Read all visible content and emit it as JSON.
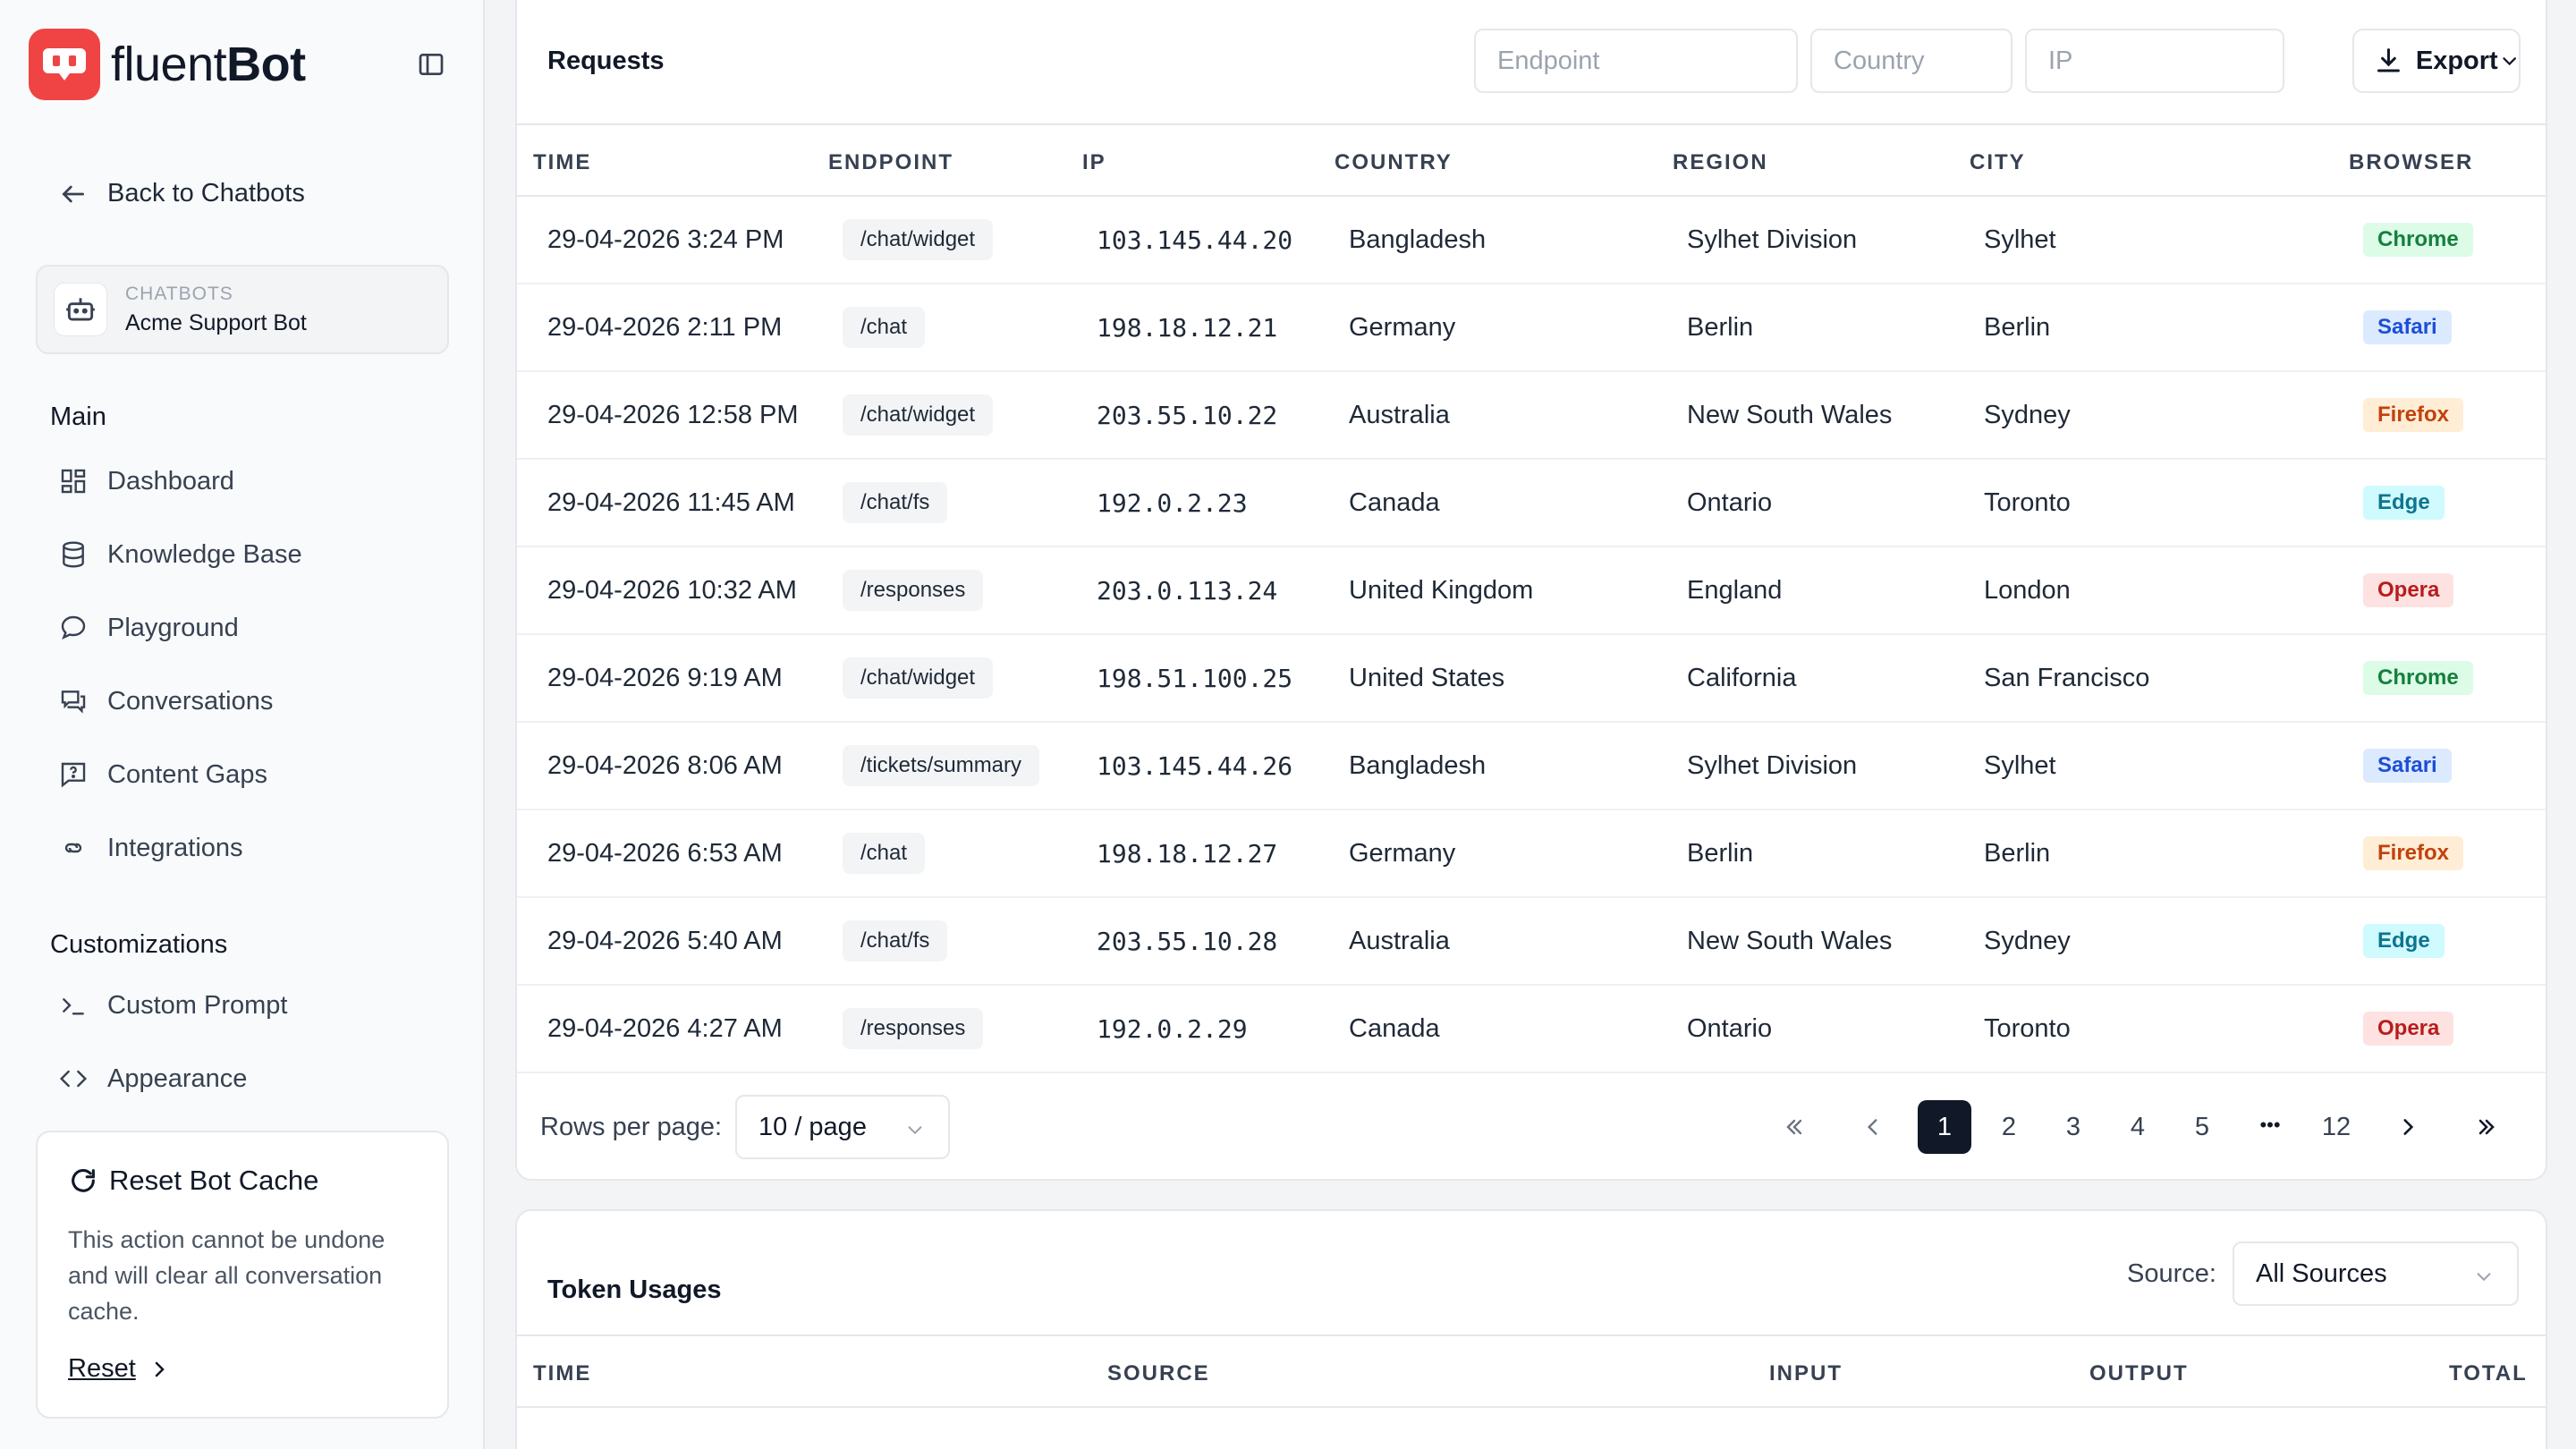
{
  "brand": {
    "name_part1": "fluent",
    "name_part2": "Bot"
  },
  "nav": {
    "back_label": "Back to Chatbots",
    "bot_card": {
      "kicker": "CHATBOTS",
      "name": "Acme Support Bot"
    },
    "main_title": "Main",
    "main_items": [
      {
        "label": "Dashboard",
        "icon": "dashboard-icon"
      },
      {
        "label": "Knowledge Base",
        "icon": "database-icon"
      },
      {
        "label": "Playground",
        "icon": "chat-bubble-icon"
      },
      {
        "label": "Conversations",
        "icon": "conversations-icon"
      },
      {
        "label": "Content Gaps",
        "icon": "question-message-icon"
      },
      {
        "label": "Integrations",
        "icon": "integrations-icon"
      }
    ],
    "custom_title": "Customizations",
    "custom_items": [
      {
        "label": "Custom Prompt",
        "icon": "terminal-icon"
      },
      {
        "label": "Appearance",
        "icon": "code-brackets-icon"
      }
    ]
  },
  "cache": {
    "title": "Reset Bot Cache",
    "description": "This action cannot be undone and will clear all conversation cache.",
    "reset_label": "Reset"
  },
  "requests": {
    "title": "Requests",
    "filters": {
      "endpoint_placeholder": "Endpoint",
      "country_placeholder": "Country",
      "ip_placeholder": "IP"
    },
    "export_label": "Export",
    "columns": [
      "TIME",
      "ENDPOINT",
      "IP",
      "COUNTRY",
      "REGION",
      "CITY",
      "BROWSER"
    ],
    "rows": [
      {
        "time": "29-04-2026 3:24 PM",
        "endpoint": "/chat/widget",
        "ip": "103.145.44.20",
        "country": "Bangladesh",
        "region": "Sylhet Division",
        "city": "Sylhet",
        "browser": "Chrome"
      },
      {
        "time": "29-04-2026 2:11 PM",
        "endpoint": "/chat",
        "ip": "198.18.12.21",
        "country": "Germany",
        "region": "Berlin",
        "city": "Berlin",
        "browser": "Safari"
      },
      {
        "time": "29-04-2026 12:58 PM",
        "endpoint": "/chat/widget",
        "ip": "203.55.10.22",
        "country": "Australia",
        "region": "New South Wales",
        "city": "Sydney",
        "browser": "Firefox"
      },
      {
        "time": "29-04-2026 11:45 AM",
        "endpoint": "/chat/fs",
        "ip": "192.0.2.23",
        "country": "Canada",
        "region": "Ontario",
        "city": "Toronto",
        "browser": "Edge"
      },
      {
        "time": "29-04-2026 10:32 AM",
        "endpoint": "/responses",
        "ip": "203.0.113.24",
        "country": "United Kingdom",
        "region": "England",
        "city": "London",
        "browser": "Opera"
      },
      {
        "time": "29-04-2026 9:19 AM",
        "endpoint": "/chat/widget",
        "ip": "198.51.100.25",
        "country": "United States",
        "region": "California",
        "city": "San Francisco",
        "browser": "Chrome"
      },
      {
        "time": "29-04-2026 8:06 AM",
        "endpoint": "/tickets/summary",
        "ip": "103.145.44.26",
        "country": "Bangladesh",
        "region": "Sylhet Division",
        "city": "Sylhet",
        "browser": "Safari"
      },
      {
        "time": "29-04-2026 6:53 AM",
        "endpoint": "/chat",
        "ip": "198.18.12.27",
        "country": "Germany",
        "region": "Berlin",
        "city": "Berlin",
        "browser": "Firefox"
      },
      {
        "time": "29-04-2026 5:40 AM",
        "endpoint": "/chat/fs",
        "ip": "203.55.10.28",
        "country": "Australia",
        "region": "New South Wales",
        "city": "Sydney",
        "browser": "Edge"
      },
      {
        "time": "29-04-2026 4:27 AM",
        "endpoint": "/responses",
        "ip": "192.0.2.29",
        "country": "Canada",
        "region": "Ontario",
        "city": "Toronto",
        "browser": "Opera"
      }
    ],
    "browser_colors": {
      "Chrome": {
        "bg": "#dcfce7",
        "fg": "#15803d"
      },
      "Safari": {
        "bg": "#dbeafe",
        "fg": "#1d4ed8"
      },
      "Firefox": {
        "bg": "#ffedd5",
        "fg": "#c2410c"
      },
      "Edge": {
        "bg": "#cffafe",
        "fg": "#0e7490"
      },
      "Opera": {
        "bg": "#fee2e2",
        "fg": "#b91c1c"
      }
    },
    "pagination": {
      "rows_per_page_label": "Rows per page:",
      "rows_per_page_value": "10 / page",
      "pages": [
        "1",
        "2",
        "3",
        "4",
        "5",
        "12"
      ],
      "ellipsis": "•••",
      "current_page": "1"
    }
  },
  "tokens": {
    "title": "Token Usages",
    "source_label": "Source:",
    "source_value": "All Sources",
    "columns": [
      "TIME",
      "SOURCE",
      "INPUT",
      "OUTPUT",
      "TOTAL"
    ]
  }
}
